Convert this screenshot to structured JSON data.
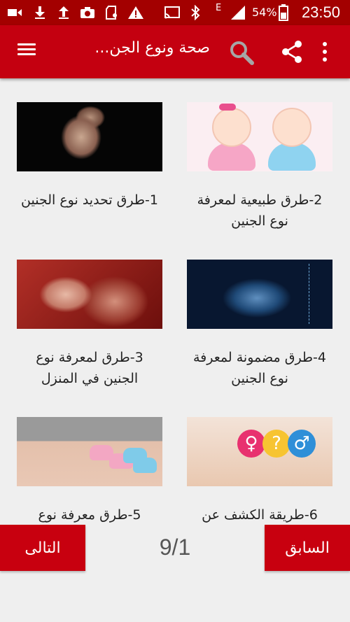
{
  "status_bar": {
    "battery_percent": "54%",
    "clock": "23:50",
    "network_label": "E",
    "icons": [
      "video-icon",
      "download-icon",
      "upload-icon",
      "camera-icon",
      "sd-card-icon",
      "warning-icon",
      "cast-icon",
      "bluetooth-icon",
      "signal-icon",
      "battery-icon"
    ]
  },
  "app_bar": {
    "title": "صحة ونوع الجن...",
    "icons": [
      "menu-icon",
      "search-icon",
      "share-icon",
      "more-vert-icon"
    ]
  },
  "articles": [
    {
      "label": "1-طرق تحديد نوع الجنين",
      "thumbnail": "fetus-dark"
    },
    {
      "label": "2-طرق طبيعية لمعرفة نوع الجنين",
      "thumbnail": "babies-pink-blue"
    },
    {
      "label": "3-طرق لمعرفة نوع الجنين في المنزل",
      "thumbnail": "fetus-womb"
    },
    {
      "label": "4-طرق مضمونة لمعرفة نوع الجنين",
      "thumbnail": "ultrasound"
    },
    {
      "label": "5-طرق معرفة نوع",
      "thumbnail": "pregnant-baby-shoes"
    },
    {
      "label": "6-طريقة الكشف عن",
      "thumbnail": "gender-symbols-belly"
    }
  ],
  "bottom_nav": {
    "next_label": "التالى",
    "prev_label": "السابق",
    "page_indicator": "9/1"
  },
  "colors": {
    "status_bar": "#a30000",
    "app_bar": "#c40010",
    "nav_button": "#c8000f",
    "background": "#efefef"
  }
}
